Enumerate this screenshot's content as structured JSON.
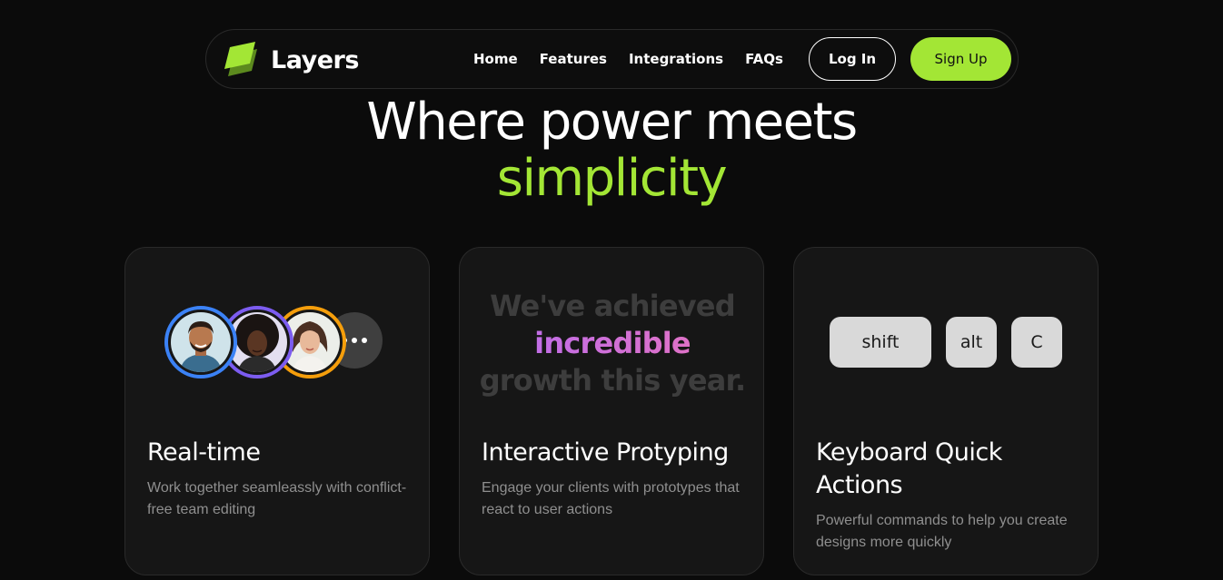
{
  "nav": {
    "brand": "Layers",
    "links": [
      "Home",
      "Features",
      "Integrations",
      "FAQs"
    ],
    "login_label": "Log In",
    "signup_label": "Sign Up"
  },
  "hero": {
    "line1": "Where power meets",
    "line2": "simplicity"
  },
  "cards": [
    {
      "title": "Real-time",
      "description": "Work together seamleassly with conflict-free team editing",
      "avatar_colors": [
        "#3b82f6",
        "#7c5cf0",
        "#f59e0b"
      ]
    },
    {
      "title": "Interactive Protyping",
      "description": "Engage your clients with prototypes that react to user actions",
      "reveal": {
        "part1": "We've achieved",
        "highlight": "incredible",
        "part2": "growth this year."
      }
    },
    {
      "title": "Keyboard Quick Actions",
      "description": "Powerful commands to help you create designs more quickly",
      "keys": [
        "shift",
        "alt",
        "C"
      ]
    }
  ],
  "colors": {
    "accent": "#a3e635",
    "background": "#0b0b0b",
    "card": "#161616"
  }
}
